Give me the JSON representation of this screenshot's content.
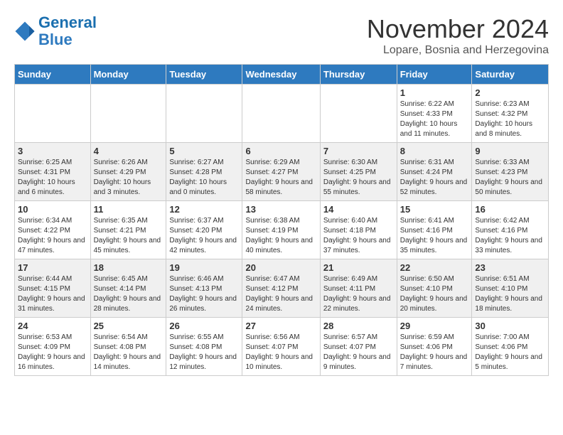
{
  "header": {
    "logo_line1": "General",
    "logo_line2": "Blue",
    "month_year": "November 2024",
    "location": "Lopare, Bosnia and Herzegovina"
  },
  "weekdays": [
    "Sunday",
    "Monday",
    "Tuesday",
    "Wednesday",
    "Thursday",
    "Friday",
    "Saturday"
  ],
  "weeks": [
    [
      {
        "day": "",
        "info": ""
      },
      {
        "day": "",
        "info": ""
      },
      {
        "day": "",
        "info": ""
      },
      {
        "day": "",
        "info": ""
      },
      {
        "day": "",
        "info": ""
      },
      {
        "day": "1",
        "info": "Sunrise: 6:22 AM\nSunset: 4:33 PM\nDaylight: 10 hours and 11 minutes."
      },
      {
        "day": "2",
        "info": "Sunrise: 6:23 AM\nSunset: 4:32 PM\nDaylight: 10 hours and 8 minutes."
      }
    ],
    [
      {
        "day": "3",
        "info": "Sunrise: 6:25 AM\nSunset: 4:31 PM\nDaylight: 10 hours and 6 minutes."
      },
      {
        "day": "4",
        "info": "Sunrise: 6:26 AM\nSunset: 4:29 PM\nDaylight: 10 hours and 3 minutes."
      },
      {
        "day": "5",
        "info": "Sunrise: 6:27 AM\nSunset: 4:28 PM\nDaylight: 10 hours and 0 minutes."
      },
      {
        "day": "6",
        "info": "Sunrise: 6:29 AM\nSunset: 4:27 PM\nDaylight: 9 hours and 58 minutes."
      },
      {
        "day": "7",
        "info": "Sunrise: 6:30 AM\nSunset: 4:25 PM\nDaylight: 9 hours and 55 minutes."
      },
      {
        "day": "8",
        "info": "Sunrise: 6:31 AM\nSunset: 4:24 PM\nDaylight: 9 hours and 52 minutes."
      },
      {
        "day": "9",
        "info": "Sunrise: 6:33 AM\nSunset: 4:23 PM\nDaylight: 9 hours and 50 minutes."
      }
    ],
    [
      {
        "day": "10",
        "info": "Sunrise: 6:34 AM\nSunset: 4:22 PM\nDaylight: 9 hours and 47 minutes."
      },
      {
        "day": "11",
        "info": "Sunrise: 6:35 AM\nSunset: 4:21 PM\nDaylight: 9 hours and 45 minutes."
      },
      {
        "day": "12",
        "info": "Sunrise: 6:37 AM\nSunset: 4:20 PM\nDaylight: 9 hours and 42 minutes."
      },
      {
        "day": "13",
        "info": "Sunrise: 6:38 AM\nSunset: 4:19 PM\nDaylight: 9 hours and 40 minutes."
      },
      {
        "day": "14",
        "info": "Sunrise: 6:40 AM\nSunset: 4:18 PM\nDaylight: 9 hours and 37 minutes."
      },
      {
        "day": "15",
        "info": "Sunrise: 6:41 AM\nSunset: 4:16 PM\nDaylight: 9 hours and 35 minutes."
      },
      {
        "day": "16",
        "info": "Sunrise: 6:42 AM\nSunset: 4:16 PM\nDaylight: 9 hours and 33 minutes."
      }
    ],
    [
      {
        "day": "17",
        "info": "Sunrise: 6:44 AM\nSunset: 4:15 PM\nDaylight: 9 hours and 31 minutes."
      },
      {
        "day": "18",
        "info": "Sunrise: 6:45 AM\nSunset: 4:14 PM\nDaylight: 9 hours and 28 minutes."
      },
      {
        "day": "19",
        "info": "Sunrise: 6:46 AM\nSunset: 4:13 PM\nDaylight: 9 hours and 26 minutes."
      },
      {
        "day": "20",
        "info": "Sunrise: 6:47 AM\nSunset: 4:12 PM\nDaylight: 9 hours and 24 minutes."
      },
      {
        "day": "21",
        "info": "Sunrise: 6:49 AM\nSunset: 4:11 PM\nDaylight: 9 hours and 22 minutes."
      },
      {
        "day": "22",
        "info": "Sunrise: 6:50 AM\nSunset: 4:10 PM\nDaylight: 9 hours and 20 minutes."
      },
      {
        "day": "23",
        "info": "Sunrise: 6:51 AM\nSunset: 4:10 PM\nDaylight: 9 hours and 18 minutes."
      }
    ],
    [
      {
        "day": "24",
        "info": "Sunrise: 6:53 AM\nSunset: 4:09 PM\nDaylight: 9 hours and 16 minutes."
      },
      {
        "day": "25",
        "info": "Sunrise: 6:54 AM\nSunset: 4:08 PM\nDaylight: 9 hours and 14 minutes."
      },
      {
        "day": "26",
        "info": "Sunrise: 6:55 AM\nSunset: 4:08 PM\nDaylight: 9 hours and 12 minutes."
      },
      {
        "day": "27",
        "info": "Sunrise: 6:56 AM\nSunset: 4:07 PM\nDaylight: 9 hours and 10 minutes."
      },
      {
        "day": "28",
        "info": "Sunrise: 6:57 AM\nSunset: 4:07 PM\nDaylight: 9 hours and 9 minutes."
      },
      {
        "day": "29",
        "info": "Sunrise: 6:59 AM\nSunset: 4:06 PM\nDaylight: 9 hours and 7 minutes."
      },
      {
        "day": "30",
        "info": "Sunrise: 7:00 AM\nSunset: 4:06 PM\nDaylight: 9 hours and 5 minutes."
      }
    ]
  ]
}
